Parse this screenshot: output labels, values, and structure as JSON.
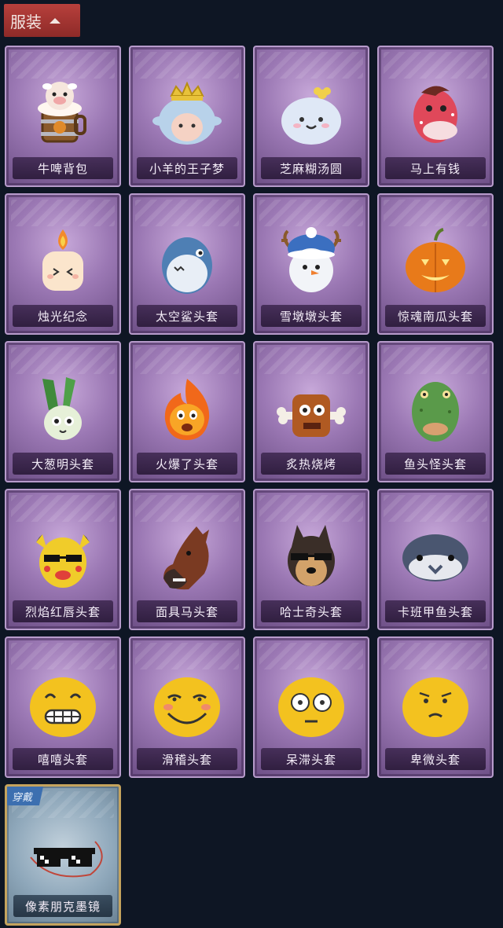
{
  "header": {
    "title": "服装"
  },
  "outfits": [
    {
      "label": "牛啤背包",
      "icon": "beer-backpack-icon"
    },
    {
      "label": "小羊的王子梦",
      "icon": "sheep-prince-icon"
    },
    {
      "label": "芝麻糊汤圆",
      "icon": "dumpling-icon"
    },
    {
      "label": "马上有钱",
      "icon": "red-horse-icon"
    },
    {
      "label": "烛光纪念",
      "icon": "candle-icon"
    },
    {
      "label": "太空鲨头套",
      "icon": "shark-hood-icon"
    },
    {
      "label": "雪墩墩头套",
      "icon": "snowman-hood-icon"
    },
    {
      "label": "惊魂南瓜头套",
      "icon": "pumpkin-hood-icon"
    },
    {
      "label": "大葱明头套",
      "icon": "scallion-hood-icon"
    },
    {
      "label": "火爆了头套",
      "icon": "fireball-hood-icon"
    },
    {
      "label": "炙热烧烤",
      "icon": "grilled-meat-icon"
    },
    {
      "label": "鱼头怪头套",
      "icon": "fish-mask-icon"
    },
    {
      "label": "烈焰红唇头套",
      "icon": "yellow-lips-hood-icon"
    },
    {
      "label": "面具马头套",
      "icon": "horse-mask-icon"
    },
    {
      "label": "哈士奇头套",
      "icon": "husky-mask-icon"
    },
    {
      "label": "卡班甲鱼头套",
      "icon": "puffer-fish-hood-icon"
    },
    {
      "label": "嘻嘻头套",
      "icon": "grin-emoji-icon"
    },
    {
      "label": "滑稽头套",
      "icon": "funny-emoji-icon"
    },
    {
      "label": "呆滞头套",
      "icon": "stare-emoji-icon"
    },
    {
      "label": "卑微头套",
      "icon": "humble-emoji-icon"
    }
  ],
  "equipped": {
    "badge": "穿戴",
    "label": "像素朋克墨镜",
    "icon": "pixel-sunglasses-icon"
  },
  "colors": {
    "header_bg": "#b7403c",
    "card_purple": "#9b78b4",
    "equipped_border": "#c4a35d",
    "badge_blue": "#3c6fb0",
    "page_bg": "#0e1624"
  }
}
